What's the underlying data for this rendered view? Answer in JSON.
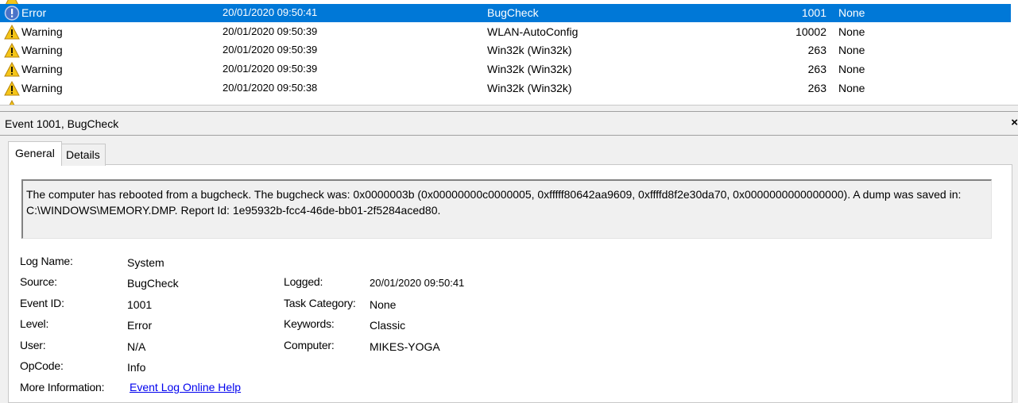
{
  "event_list": {
    "rows": [
      {
        "level": "Error",
        "date": "20/01/2020 09:50:41",
        "source": "BugCheck",
        "event_id": "1001",
        "task": "None",
        "icon": "error-icon"
      },
      {
        "level": "Warning",
        "date": "20/01/2020 09:50:39",
        "source": "WLAN-AutoConfig",
        "event_id": "10002",
        "task": "None",
        "icon": "warning-icon"
      },
      {
        "level": "Warning",
        "date": "20/01/2020 09:50:39",
        "source": "Win32k (Win32k)",
        "event_id": "263",
        "task": "None",
        "icon": "warning-icon"
      },
      {
        "level": "Warning",
        "date": "20/01/2020 09:50:39",
        "source": "Win32k (Win32k)",
        "event_id": "263",
        "task": "None",
        "icon": "warning-icon"
      },
      {
        "level": "Warning",
        "date": "20/01/2020 09:50:38",
        "source": "Win32k (Win32k)",
        "event_id": "263",
        "task": "None",
        "icon": "warning-icon"
      }
    ],
    "selected_color": "#0078d7"
  },
  "detail": {
    "title": "Event 1001, BugCheck",
    "close_glyph": "×",
    "tabs": [
      "General",
      "Details"
    ],
    "description": "The computer has rebooted from a bugcheck.  The bugcheck was: 0x0000003b (0x00000000c0000005, 0xfffff80642aa9609, 0xffffd8f2e30da70, 0x0000000000000000). A dump was saved in: C:\\WINDOWS\\MEMORY.DMP. Report Id: 1e95932b-fcc4-46de-bb01-2f5284aced80.",
    "props": {
      "log_name_label": "Log Name:",
      "log_name": "System",
      "source_label": "Source:",
      "source": "BugCheck",
      "logged_label": "Logged:",
      "logged": "20/01/2020 09:50:41",
      "event_id_label": "Event ID:",
      "event_id": "1001",
      "task_category_label": "Task Category:",
      "task_category": "None",
      "level_label": "Level:",
      "level": "Error",
      "keywords_label": "Keywords:",
      "keywords": "Classic",
      "user_label": "User:",
      "user": "N/A",
      "computer_label": "Computer:",
      "computer": "MIKES-YOGA",
      "opcode_label": "OpCode:",
      "opcode": "Info",
      "more_info_label": "More Information:",
      "more_info_link": "Event Log Online Help"
    }
  }
}
